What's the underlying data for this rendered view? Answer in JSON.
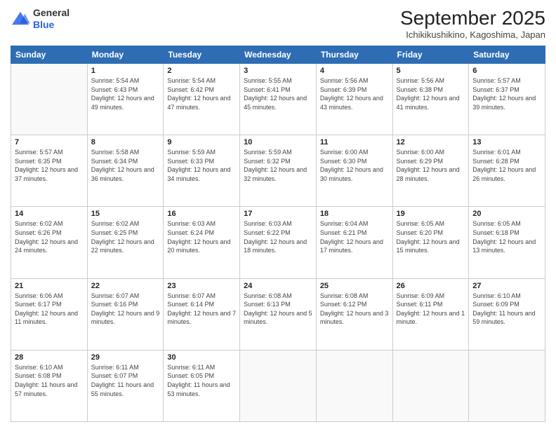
{
  "header": {
    "logo_general": "General",
    "logo_blue": "Blue",
    "month_title": "September 2025",
    "subtitle": "Ichikikushikino, Kagoshima, Japan"
  },
  "days_of_week": [
    "Sunday",
    "Monday",
    "Tuesday",
    "Wednesday",
    "Thursday",
    "Friday",
    "Saturday"
  ],
  "weeks": [
    [
      {
        "num": "",
        "sunrise": "",
        "sunset": "",
        "daylight": ""
      },
      {
        "num": "1",
        "sunrise": "Sunrise: 5:54 AM",
        "sunset": "Sunset: 6:43 PM",
        "daylight": "Daylight: 12 hours and 49 minutes."
      },
      {
        "num": "2",
        "sunrise": "Sunrise: 5:54 AM",
        "sunset": "Sunset: 6:42 PM",
        "daylight": "Daylight: 12 hours and 47 minutes."
      },
      {
        "num": "3",
        "sunrise": "Sunrise: 5:55 AM",
        "sunset": "Sunset: 6:41 PM",
        "daylight": "Daylight: 12 hours and 45 minutes."
      },
      {
        "num": "4",
        "sunrise": "Sunrise: 5:56 AM",
        "sunset": "Sunset: 6:39 PM",
        "daylight": "Daylight: 12 hours and 43 minutes."
      },
      {
        "num": "5",
        "sunrise": "Sunrise: 5:56 AM",
        "sunset": "Sunset: 6:38 PM",
        "daylight": "Daylight: 12 hours and 41 minutes."
      },
      {
        "num": "6",
        "sunrise": "Sunrise: 5:57 AM",
        "sunset": "Sunset: 6:37 PM",
        "daylight": "Daylight: 12 hours and 39 minutes."
      }
    ],
    [
      {
        "num": "7",
        "sunrise": "Sunrise: 5:57 AM",
        "sunset": "Sunset: 6:35 PM",
        "daylight": "Daylight: 12 hours and 37 minutes."
      },
      {
        "num": "8",
        "sunrise": "Sunrise: 5:58 AM",
        "sunset": "Sunset: 6:34 PM",
        "daylight": "Daylight: 12 hours and 36 minutes."
      },
      {
        "num": "9",
        "sunrise": "Sunrise: 5:59 AM",
        "sunset": "Sunset: 6:33 PM",
        "daylight": "Daylight: 12 hours and 34 minutes."
      },
      {
        "num": "10",
        "sunrise": "Sunrise: 5:59 AM",
        "sunset": "Sunset: 6:32 PM",
        "daylight": "Daylight: 12 hours and 32 minutes."
      },
      {
        "num": "11",
        "sunrise": "Sunrise: 6:00 AM",
        "sunset": "Sunset: 6:30 PM",
        "daylight": "Daylight: 12 hours and 30 minutes."
      },
      {
        "num": "12",
        "sunrise": "Sunrise: 6:00 AM",
        "sunset": "Sunset: 6:29 PM",
        "daylight": "Daylight: 12 hours and 28 minutes."
      },
      {
        "num": "13",
        "sunrise": "Sunrise: 6:01 AM",
        "sunset": "Sunset: 6:28 PM",
        "daylight": "Daylight: 12 hours and 26 minutes."
      }
    ],
    [
      {
        "num": "14",
        "sunrise": "Sunrise: 6:02 AM",
        "sunset": "Sunset: 6:26 PM",
        "daylight": "Daylight: 12 hours and 24 minutes."
      },
      {
        "num": "15",
        "sunrise": "Sunrise: 6:02 AM",
        "sunset": "Sunset: 6:25 PM",
        "daylight": "Daylight: 12 hours and 22 minutes."
      },
      {
        "num": "16",
        "sunrise": "Sunrise: 6:03 AM",
        "sunset": "Sunset: 6:24 PM",
        "daylight": "Daylight: 12 hours and 20 minutes."
      },
      {
        "num": "17",
        "sunrise": "Sunrise: 6:03 AM",
        "sunset": "Sunset: 6:22 PM",
        "daylight": "Daylight: 12 hours and 18 minutes."
      },
      {
        "num": "18",
        "sunrise": "Sunrise: 6:04 AM",
        "sunset": "Sunset: 6:21 PM",
        "daylight": "Daylight: 12 hours and 17 minutes."
      },
      {
        "num": "19",
        "sunrise": "Sunrise: 6:05 AM",
        "sunset": "Sunset: 6:20 PM",
        "daylight": "Daylight: 12 hours and 15 minutes."
      },
      {
        "num": "20",
        "sunrise": "Sunrise: 6:05 AM",
        "sunset": "Sunset: 6:18 PM",
        "daylight": "Daylight: 12 hours and 13 minutes."
      }
    ],
    [
      {
        "num": "21",
        "sunrise": "Sunrise: 6:06 AM",
        "sunset": "Sunset: 6:17 PM",
        "daylight": "Daylight: 12 hours and 11 minutes."
      },
      {
        "num": "22",
        "sunrise": "Sunrise: 6:07 AM",
        "sunset": "Sunset: 6:16 PM",
        "daylight": "Daylight: 12 hours and 9 minutes."
      },
      {
        "num": "23",
        "sunrise": "Sunrise: 6:07 AM",
        "sunset": "Sunset: 6:14 PM",
        "daylight": "Daylight: 12 hours and 7 minutes."
      },
      {
        "num": "24",
        "sunrise": "Sunrise: 6:08 AM",
        "sunset": "Sunset: 6:13 PM",
        "daylight": "Daylight: 12 hours and 5 minutes."
      },
      {
        "num": "25",
        "sunrise": "Sunrise: 6:08 AM",
        "sunset": "Sunset: 6:12 PM",
        "daylight": "Daylight: 12 hours and 3 minutes."
      },
      {
        "num": "26",
        "sunrise": "Sunrise: 6:09 AM",
        "sunset": "Sunset: 6:11 PM",
        "daylight": "Daylight: 12 hours and 1 minute."
      },
      {
        "num": "27",
        "sunrise": "Sunrise: 6:10 AM",
        "sunset": "Sunset: 6:09 PM",
        "daylight": "Daylight: 11 hours and 59 minutes."
      }
    ],
    [
      {
        "num": "28",
        "sunrise": "Sunrise: 6:10 AM",
        "sunset": "Sunset: 6:08 PM",
        "daylight": "Daylight: 11 hours and 57 minutes."
      },
      {
        "num": "29",
        "sunrise": "Sunrise: 6:11 AM",
        "sunset": "Sunset: 6:07 PM",
        "daylight": "Daylight: 11 hours and 55 minutes."
      },
      {
        "num": "30",
        "sunrise": "Sunrise: 6:11 AM",
        "sunset": "Sunset: 6:05 PM",
        "daylight": "Daylight: 11 hours and 53 minutes."
      },
      {
        "num": "",
        "sunrise": "",
        "sunset": "",
        "daylight": ""
      },
      {
        "num": "",
        "sunrise": "",
        "sunset": "",
        "daylight": ""
      },
      {
        "num": "",
        "sunrise": "",
        "sunset": "",
        "daylight": ""
      },
      {
        "num": "",
        "sunrise": "",
        "sunset": "",
        "daylight": ""
      }
    ]
  ]
}
